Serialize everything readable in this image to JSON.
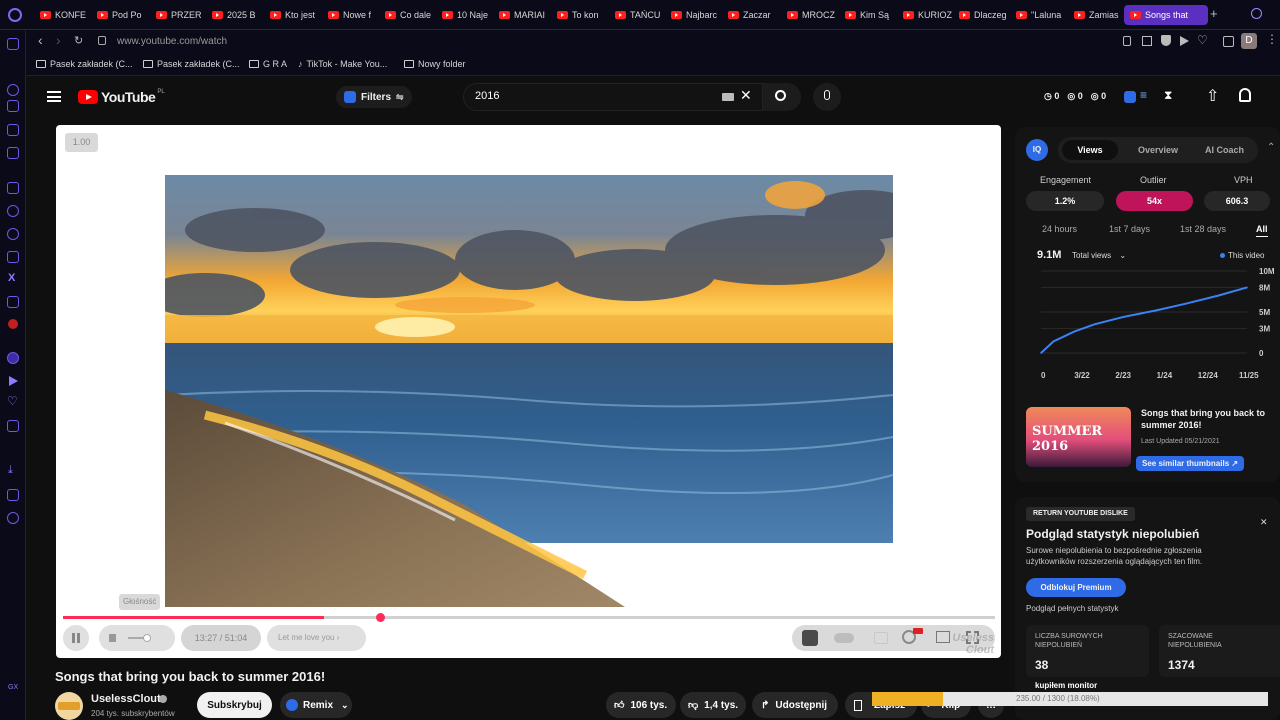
{
  "browser": {
    "tabs": [
      {
        "label": "KONFE"
      },
      {
        "label": "Pod Po"
      },
      {
        "label": "PRZER"
      },
      {
        "label": "2025 B"
      },
      {
        "label": "Kto jest"
      },
      {
        "label": "Nowe f"
      },
      {
        "label": "Co dale"
      },
      {
        "label": "10 Naje"
      },
      {
        "label": "MARIAI"
      },
      {
        "label": "To kon"
      },
      {
        "label": "TAŃCU"
      },
      {
        "label": "Najbarc"
      },
      {
        "label": "Zaczar"
      },
      {
        "label": "MROCZ"
      },
      {
        "label": "Kim Są"
      },
      {
        "label": "KURIOZ"
      },
      {
        "label": "Dlaczeg"
      },
      {
        "label": "\"Laluna"
      },
      {
        "label": "Zamias"
      }
    ],
    "active_tab": "Songs that",
    "url": "www.youtube.com/watch",
    "bookmarks": [
      "Pasek zakładek (C...",
      "Pasek zakładek (C...",
      "G R A",
      "TikTok - Make You...",
      "Nowy folder"
    ],
    "profile_initial": "D"
  },
  "header": {
    "logo_text": "YouTube",
    "logo_country": "PL",
    "filters_label": "Filters",
    "search_value": "2016",
    "counters": [
      "0",
      "0",
      "0"
    ]
  },
  "player": {
    "speed_badge": "1.00",
    "volume_tooltip": "Głośność",
    "time": "13:27 / 51:04",
    "chapter": "Let me love you",
    "progress_fraction": 0.28,
    "watermark": "Useless Clout"
  },
  "video": {
    "title": "Songs that bring you back to summer 2016!",
    "channel": "UselessClout",
    "subs": "204 tys. subskrybentów",
    "subscribe_label": "Subskrybuj",
    "remix_label": "Remix",
    "likes": "106 tys.",
    "dislikes": "1,4 tys.",
    "share_label": "Udostępnij",
    "save_label": "Zapisz",
    "clip_label": "Klip"
  },
  "vidiq": {
    "tabs": [
      "Views",
      "Overview",
      "AI Coach"
    ],
    "metrics": [
      {
        "label": "Engagement",
        "value": "1.2%"
      },
      {
        "label": "Outlier",
        "value": "54x"
      },
      {
        "label": "VPH",
        "value": "606.3"
      }
    ],
    "ranges": [
      "24 hours",
      "1st 7 days",
      "1st 28 days",
      "All"
    ],
    "total_views": "9.1M",
    "views_dropdown": "Total views",
    "legend": "This video",
    "thumb_text": "SUMMER 2016",
    "thumb_title": "Songs that bring you back to summer 2016!",
    "last_updated": "Last Updated 05/21/2021",
    "similar_label": "See similar thumbnails"
  },
  "chart_data": {
    "type": "line",
    "x_ticks": [
      "0",
      "3/22",
      "2/23",
      "1/24",
      "12/24",
      "11/25"
    ],
    "y_ticks": [
      "0",
      "3M",
      "5M",
      "8M",
      "10M"
    ],
    "ylim": [
      0,
      10
    ],
    "series": [
      {
        "name": "This video",
        "x": [
          0,
          0.3,
          0.8,
          1.3,
          2.0,
          2.8,
          3.5,
          4.3,
          5.0
        ],
        "y": [
          0,
          1.4,
          2.6,
          3.5,
          4.4,
          5.2,
          6.0,
          7.0,
          8.0
        ]
      }
    ]
  },
  "ryd": {
    "header": "RETURN YOUTUBE DISLIKE",
    "title": "Podgląd statystyk niepolubień",
    "description": "Surowe niepolubienia to bezpośrednie zgłoszenia użytkowników rozszerzenia oglądających ten film.",
    "unlock_label": "Odblokuj Premium",
    "preview_label": "Podgląd pełnych statystyk",
    "raw_label": "LICZBA SUROWYCH NIEPOLUBIEŃ",
    "raw_value": "38",
    "est_label": "SZACOWANE NIEPOLUBIENIA",
    "est_value": "1374",
    "bottom_label": "kupiłem monitor",
    "overlay_progress": "235.00 / 1300 (18.08%)",
    "overlay_fraction": 0.18
  },
  "colors": {
    "brand_red": "#ff0000",
    "vidiq_blue": "#3b82f6",
    "outlier_pink": "#c0145a",
    "progress_red": "#ff2d55",
    "browser_accent": "#5b2fbf"
  }
}
